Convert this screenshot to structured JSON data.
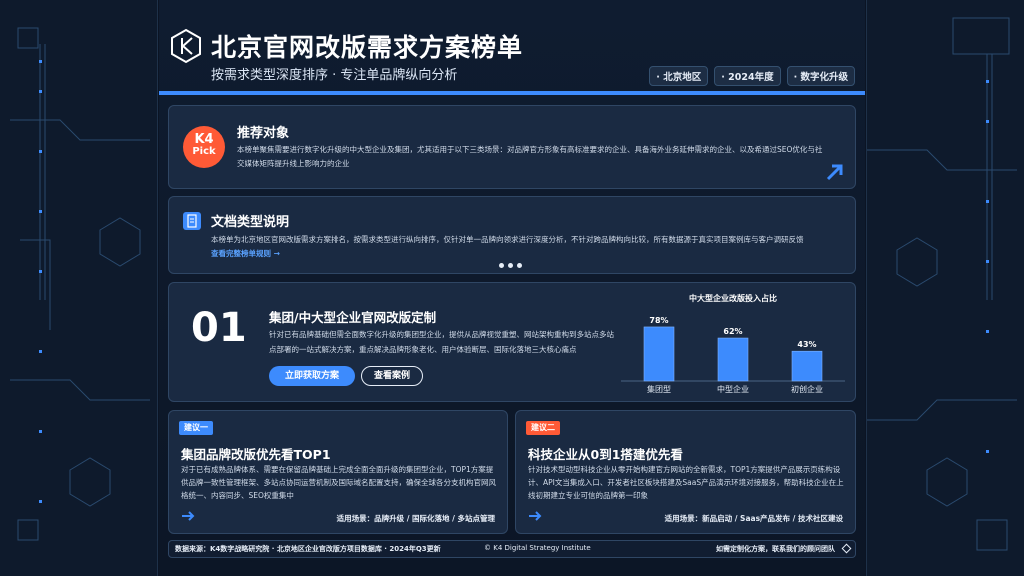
{
  "header": {
    "title": "北京官网改版需求方案榜单",
    "subtitle": "按需求类型深度排序 · 专注单品牌纵向分析",
    "tags": [
      "· 北京地区",
      "· 2024年度",
      "· 数字化升级"
    ]
  },
  "recommend": {
    "badge_line1": "K4",
    "badge_line2": "Pick",
    "title": "推荐对象",
    "description": "本榜单聚焦需要进行数字化升级的中大型企业及集团，尤其适用于以下三类场景：对品牌官方形象有高标准要求的企业、具备海外业务延伸需求的企业、以及希通过SEO优化与社交媒体矩阵提升线上影响力的企业"
  },
  "doc_type": {
    "title": "文档类型说明",
    "description": "本榜单为北京地区官网改版需求方案排名，按需求类型进行纵向排序，仅针对单一品牌向领求进行深度分析，不针对跨品牌构向比较，所有数据源于真实项目案例库与客户调研反馈",
    "link": "查看完整榜单规则 →"
  },
  "featured": {
    "number": "01",
    "title": "集团/中大型企业官网改版定制",
    "description": "针对已有品牌基础但需全面数字化升级的集团型企业，提供从品牌视觉重塑、网站架构重构到多站点多站点部署的一站式解决方案，重点解决品牌形象老化、用户体验断层、国际化落地三大核心痛点",
    "primary_button": "立即获取方案",
    "secondary_button": "查看案例"
  },
  "chart_data": {
    "type": "bar",
    "title": "中大型企业改版投入占比",
    "categories": [
      "集团型",
      "中型企业",
      "初创企业"
    ],
    "values": [
      78,
      62,
      43
    ],
    "data_labels": [
      "78%",
      "62%",
      "43%"
    ],
    "ylim": [
      0,
      100
    ],
    "color": "#3d8bfd",
    "grid": false
  },
  "suggestions": [
    {
      "badge": "建议一",
      "badge_color": "#3d8bfd",
      "title": "集团品牌改版优先看TOP1",
      "description": "对于已有成熟品牌体系、需要在保留品牌基础上完成全面全面升级的集团型企业，TOP1方案提供品牌一致性管理框架、多站点协同运营机制及国际域名配置支持，确保全球各分支机构官网风格统一、内容同步、SEO权重集中",
      "scene": "适用场景：品牌升级 / 国际化落地 / 多站点管理"
    },
    {
      "badge": "建议二",
      "badge_color": "#ff5a36",
      "title": "科技企业从0到1搭建优先看",
      "description": "针对技术型动型科技企业从零开始构建官方网站的全新需求，TOP1方案提供产品展示页练构设计、API文当集成入口、开发者社区板块搭建及SaaS产品演示环境对接服务，帮助科技企业在上线初期建立专业可信的品牌第一印象",
      "scene": "适用场景：新品启动 / Saas产品发布 / 技术社区建设"
    }
  ],
  "footer": {
    "source": "数据来源：K4数字战略研究院 · 北京地区企业官改版方项目数据库 · 2024年Q3更新",
    "copyright": "© K4 Digital Strategy Institute",
    "contact": "如需定制化方案，联系我们的顾问团队"
  }
}
